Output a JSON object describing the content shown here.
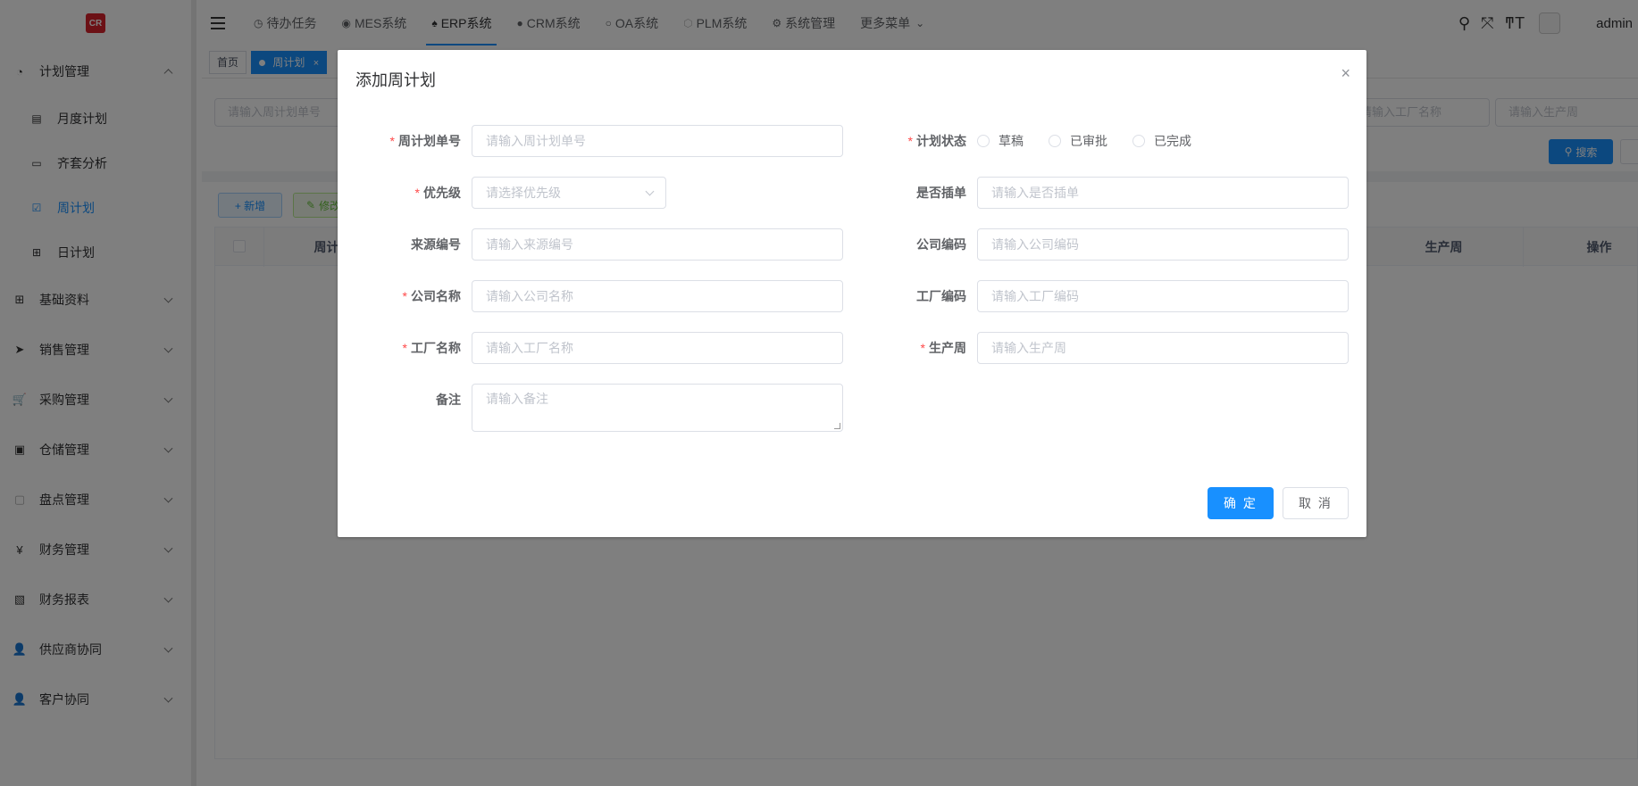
{
  "logo": {
    "text": "CR"
  },
  "sidebar": {
    "groups": [
      {
        "label": "计划管理",
        "icon": "chart-icon",
        "expanded": true,
        "children": [
          {
            "label": "月度计划",
            "icon": "document-icon"
          },
          {
            "label": "齐套分析",
            "icon": "list-icon"
          },
          {
            "label": "周计划",
            "icon": "checkbox-icon",
            "active": true
          },
          {
            "label": "日计划",
            "icon": "grid-icon"
          }
        ]
      },
      {
        "label": "基础资料",
        "icon": "grid-icon"
      },
      {
        "label": "销售管理",
        "icon": "send-icon"
      },
      {
        "label": "采购管理",
        "icon": "cart-icon"
      },
      {
        "label": "仓储管理",
        "icon": "warehouse-icon"
      },
      {
        "label": "盘点管理",
        "icon": "box-icon"
      },
      {
        "label": "财务管理",
        "icon": "yen-icon"
      },
      {
        "label": "财务报表",
        "icon": "report-icon"
      },
      {
        "label": "供应商协同",
        "icon": "user-icon"
      },
      {
        "label": "客户协同",
        "icon": "user-icon"
      }
    ]
  },
  "header": {
    "nav": [
      {
        "label": "待办任务",
        "icon": "clock-icon"
      },
      {
        "label": "MES系统",
        "icon": "globe-icon"
      },
      {
        "label": "ERP系统",
        "icon": "tree-icon",
        "active": true
      },
      {
        "label": "CRM系统",
        "icon": "user-icon"
      },
      {
        "label": "OA系统",
        "icon": "circle-icon"
      },
      {
        "label": "PLM系统",
        "icon": "cube-icon"
      },
      {
        "label": "系统管理",
        "icon": "gear-icon"
      },
      {
        "label": "更多菜单",
        "icon": "chevron-down-icon"
      }
    ],
    "username": "admin"
  },
  "tags": [
    {
      "label": "首页"
    },
    {
      "label": "周计划",
      "active": true,
      "close": "×"
    }
  ],
  "background": {
    "search_placeholders": {
      "plan_no": "请输入周计划单号",
      "factory_name": "请输入工厂名称",
      "production_week": "请输入生产周"
    },
    "search_button": "搜索",
    "add_button": "+ 新增",
    "edit_button": "修改",
    "columns": [
      "周计",
      "生产周",
      "操作"
    ]
  },
  "dialog": {
    "title": "添加周计划",
    "close": "×",
    "fields": {
      "plan_no": {
        "label": "周计划单号",
        "required": "*",
        "placeholder": "请输入周计划单号"
      },
      "status": {
        "label": "计划状态",
        "required": "*",
        "options": [
          "草稿",
          "已审批",
          "已完成"
        ]
      },
      "priority": {
        "label": "优先级",
        "required": "*",
        "placeholder": "请选择优先级"
      },
      "insert_order": {
        "label": "是否插单",
        "placeholder": "请输入是否插单"
      },
      "source_no": {
        "label": "来源编号",
        "placeholder": "请输入来源编号"
      },
      "company_code": {
        "label": "公司编码",
        "placeholder": "请输入公司编码"
      },
      "company_name": {
        "label": "公司名称",
        "required": "*",
        "placeholder": "请输入公司名称"
      },
      "factory_code": {
        "label": "工厂编码",
        "placeholder": "请输入工厂编码"
      },
      "factory_name": {
        "label": "工厂名称",
        "required": "*",
        "placeholder": "请输入工厂名称"
      },
      "production_week": {
        "label": "生产周",
        "required": "*",
        "placeholder": "请输入生产周"
      },
      "remark": {
        "label": "备注",
        "placeholder": "请输入备注"
      }
    },
    "ok_button": "确 定",
    "cancel_button": "取 消"
  }
}
